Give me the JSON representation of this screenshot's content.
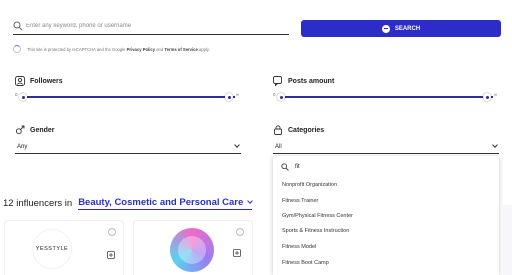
{
  "search": {
    "placeholder": "Enter any keyword, phone or username",
    "button_label": "SEARCH",
    "icon": "search-icon"
  },
  "captcha": {
    "text_before": "This site is protected by reCAPTCHA and the Google",
    "privacy_link": "Privacy Policy",
    "text_middle": "and",
    "terms_link": "Terms of Service",
    "text_after": "apply."
  },
  "filters": {
    "followers": {
      "label": "Followers",
      "min_label": "0",
      "max_label": "∞",
      "min_value": 0,
      "max_value": 1,
      "icon": "user-icon"
    },
    "posts": {
      "label": "Posts amount",
      "min_label": "0",
      "max_label": "∞",
      "min_value": 0,
      "max_value": 1,
      "icon": "posts-icon"
    },
    "gender": {
      "label": "Gender",
      "value": "Any",
      "icon": "gender-icon"
    },
    "categories": {
      "label": "Categories",
      "value": "All",
      "icon": "categories-icon"
    }
  },
  "dropdown": {
    "query": "fit",
    "options": [
      "Nonprofit Organization",
      "Fitness Trainer",
      "Gym/Physical Fitness Center",
      "Sports & Fitness Instruction",
      "Fitness Model",
      "Fitness Boot Camp"
    ]
  },
  "results": {
    "count_text": "12 influencers in",
    "category": "Beauty, Cosmetic and Personal Care"
  },
  "cards": [
    {
      "logo_text": "YESSTYLE"
    },
    {
      "logo_text": ""
    }
  ],
  "colors": {
    "accent": "#2c2cc9",
    "slider_track": "#2f2f96"
  }
}
